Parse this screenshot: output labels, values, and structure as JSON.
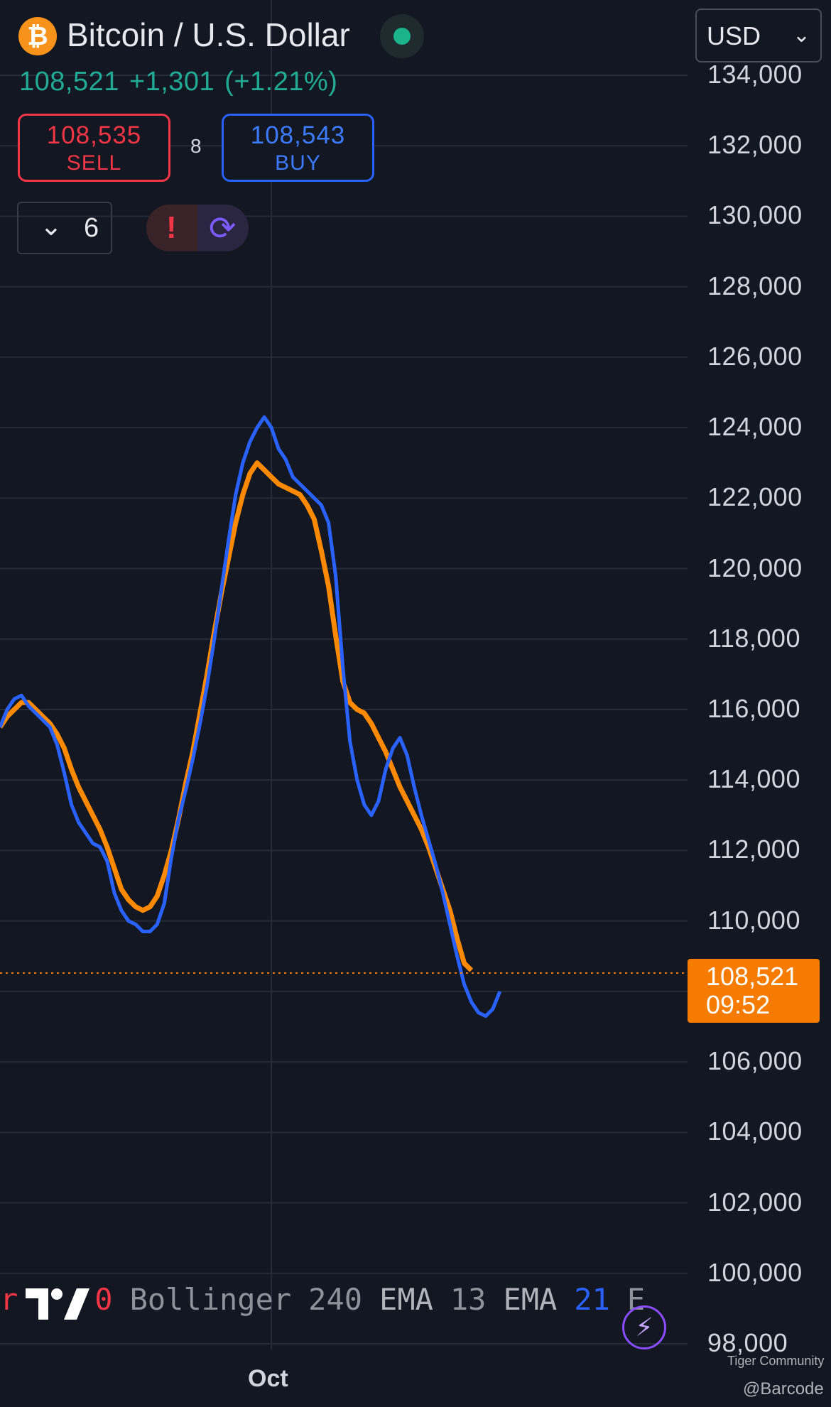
{
  "header": {
    "title": "Bitcoin / U.S. Dollar",
    "logo_glyph": "₿",
    "last_price": "108,521",
    "change": "+1,301",
    "change_pct": "(+1.21%)",
    "currency": "USD"
  },
  "trade": {
    "sell_price": "108,535",
    "sell_label": "SELL",
    "buy_price": "108,543",
    "buy_label": "BUY",
    "spread": "8"
  },
  "indicators_toggle": {
    "count": "6"
  },
  "legend_text": [
    "r",
    "0",
    "Bollinger",
    "240",
    "EMA",
    "13",
    "EMA",
    "21",
    "E"
  ],
  "price_tag": {
    "price": "108,521",
    "countdown": "09:52"
  },
  "watermark": {
    "line1": "Tiger Community",
    "line2": "@Barcode"
  },
  "colors": {
    "background": "#131722",
    "up": "#22ab94",
    "down": "#f23645",
    "ema_fast": "#2962ff",
    "ema_slow": "#ff8a00",
    "bands_magenta": "#e91edb",
    "bands_grey": "#5d606b",
    "price_tag": "#f57c00"
  },
  "chart_data": {
    "type": "line",
    "title": "",
    "xlabel": "",
    "ylabel": "",
    "ylim": [
      98000,
      134000
    ],
    "y_ticks": [
      "134,000",
      "132,000",
      "130,000",
      "128,000",
      "126,000",
      "124,000",
      "122,000",
      "120,000",
      "118,000",
      "116,000",
      "114,000",
      "112,000",
      "110,000",
      "108,000",
      "106,000",
      "104,000",
      "102,000",
      "100,000",
      "98,000"
    ],
    "y_tick_values": [
      134000,
      132000,
      130000,
      128000,
      126000,
      124000,
      122000,
      120000,
      118000,
      116000,
      114000,
      112000,
      110000,
      108000,
      106000,
      104000,
      102000,
      100000,
      98000
    ],
    "x_tick_labels": [
      "Oct"
    ],
    "x_index": [
      0,
      1,
      2,
      3,
      4,
      5,
      6,
      7,
      8,
      9,
      10,
      11,
      12,
      13,
      14,
      15,
      16,
      17,
      18,
      19,
      20,
      21,
      22,
      23,
      24,
      25,
      26,
      27,
      28,
      29,
      30,
      31,
      32,
      33,
      34,
      35,
      36,
      37,
      38,
      39,
      40,
      41,
      42,
      43,
      44,
      45,
      46,
      47,
      48,
      49,
      50,
      51,
      52,
      53,
      54,
      55,
      56,
      57,
      58,
      59,
      60,
      61,
      62,
      63,
      64,
      65,
      66,
      67,
      68,
      69,
      70,
      71,
      72,
      73,
      74,
      75,
      76,
      77,
      78,
      79,
      80,
      81,
      82,
      83,
      84,
      85,
      86,
      87,
      88,
      89,
      90
    ],
    "x_tick_index": [
      38
    ],
    "series": [
      {
        "name": "EMA 13",
        "values": [
          115500,
          116000,
          116300,
          116400,
          116100,
          115900,
          115700,
          115500,
          115000,
          114200,
          113300,
          112800,
          112500,
          112200,
          112100,
          111700,
          110800,
          110300,
          110000,
          109900,
          109700,
          109700,
          109900,
          110500,
          111800,
          112900,
          113700,
          114600,
          115600,
          116700,
          118000,
          119400,
          120800,
          122100,
          123000,
          123600,
          124000,
          124300,
          124000,
          123400,
          123100,
          122600,
          122400,
          122200,
          122000,
          121800,
          121300,
          119800,
          117200,
          115100,
          114000,
          113300,
          113000,
          113400,
          114300,
          114900,
          115200,
          114700,
          113800,
          113000,
          112300,
          111600,
          110800,
          109900,
          109000,
          108200,
          107700,
          107400,
          107300,
          107500,
          108000
        ]
      },
      {
        "name": "EMA 21",
        "values": [
          115500,
          115800,
          116000,
          116200,
          116200,
          116000,
          115800,
          115600,
          115300,
          114900,
          114300,
          113800,
          113400,
          113000,
          112600,
          112100,
          111500,
          110900,
          110600,
          110400,
          110300,
          110400,
          110700,
          111300,
          112000,
          112900,
          113900,
          114800,
          115900,
          117000,
          118200,
          119300,
          120300,
          121300,
          122100,
          122700,
          123000,
          122800,
          122600,
          122400,
          122300,
          122200,
          122100,
          121800,
          121400,
          120500,
          119500,
          118100,
          116800,
          116200,
          116000,
          115900,
          115600,
          115200,
          114800,
          114300,
          113800,
          113400,
          113000,
          112600,
          112100,
          111500,
          110900,
          110300,
          109500,
          108800,
          108600
        ]
      }
    ]
  }
}
